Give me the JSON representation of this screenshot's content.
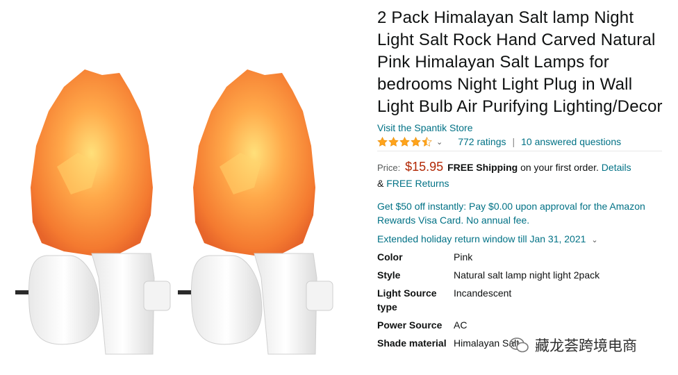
{
  "product": {
    "title": "2 Pack Himalayan Salt lamp Night Light Salt Rock Hand Carved Natural Pink Himalayan Salt Lamps for bedrooms Night Light Plug in Wall Light Bulb Air Purifying Lighting/Decor",
    "store_link": "Visit the Spantik Store",
    "rating_stars": 4.5,
    "ratings_count": "772 ratings",
    "answered_questions": "10 answered questions",
    "price_label": "Price:",
    "price": "$15.95",
    "free_shipping": "FREE Shipping",
    "shipping_suffix": "on your first order.",
    "details_link": "Details",
    "returns_prefix": "&",
    "free_returns": "FREE Returns",
    "offer": "Get $50 off instantly: Pay $0.00 upon approval for the Amazon Rewards Visa Card. No annual fee.",
    "holiday_return": "Extended holiday return window till Jan 31, 2021"
  },
  "specs": [
    {
      "key": "Color",
      "value": "Pink"
    },
    {
      "key": "Style",
      "value": "Natural salt lamp night light 2pack"
    },
    {
      "key": "Light Source type",
      "value": "Incandescent"
    },
    {
      "key": "Power Source",
      "value": "AC"
    },
    {
      "key": "Shade material",
      "value": "Himalayan Salt"
    }
  ],
  "watermark": {
    "text": "藏龙荟跨境电商"
  },
  "colors": {
    "link": "#007185",
    "price": "#B12704",
    "star": "#FFA41C",
    "salt": "#F58A3C"
  }
}
